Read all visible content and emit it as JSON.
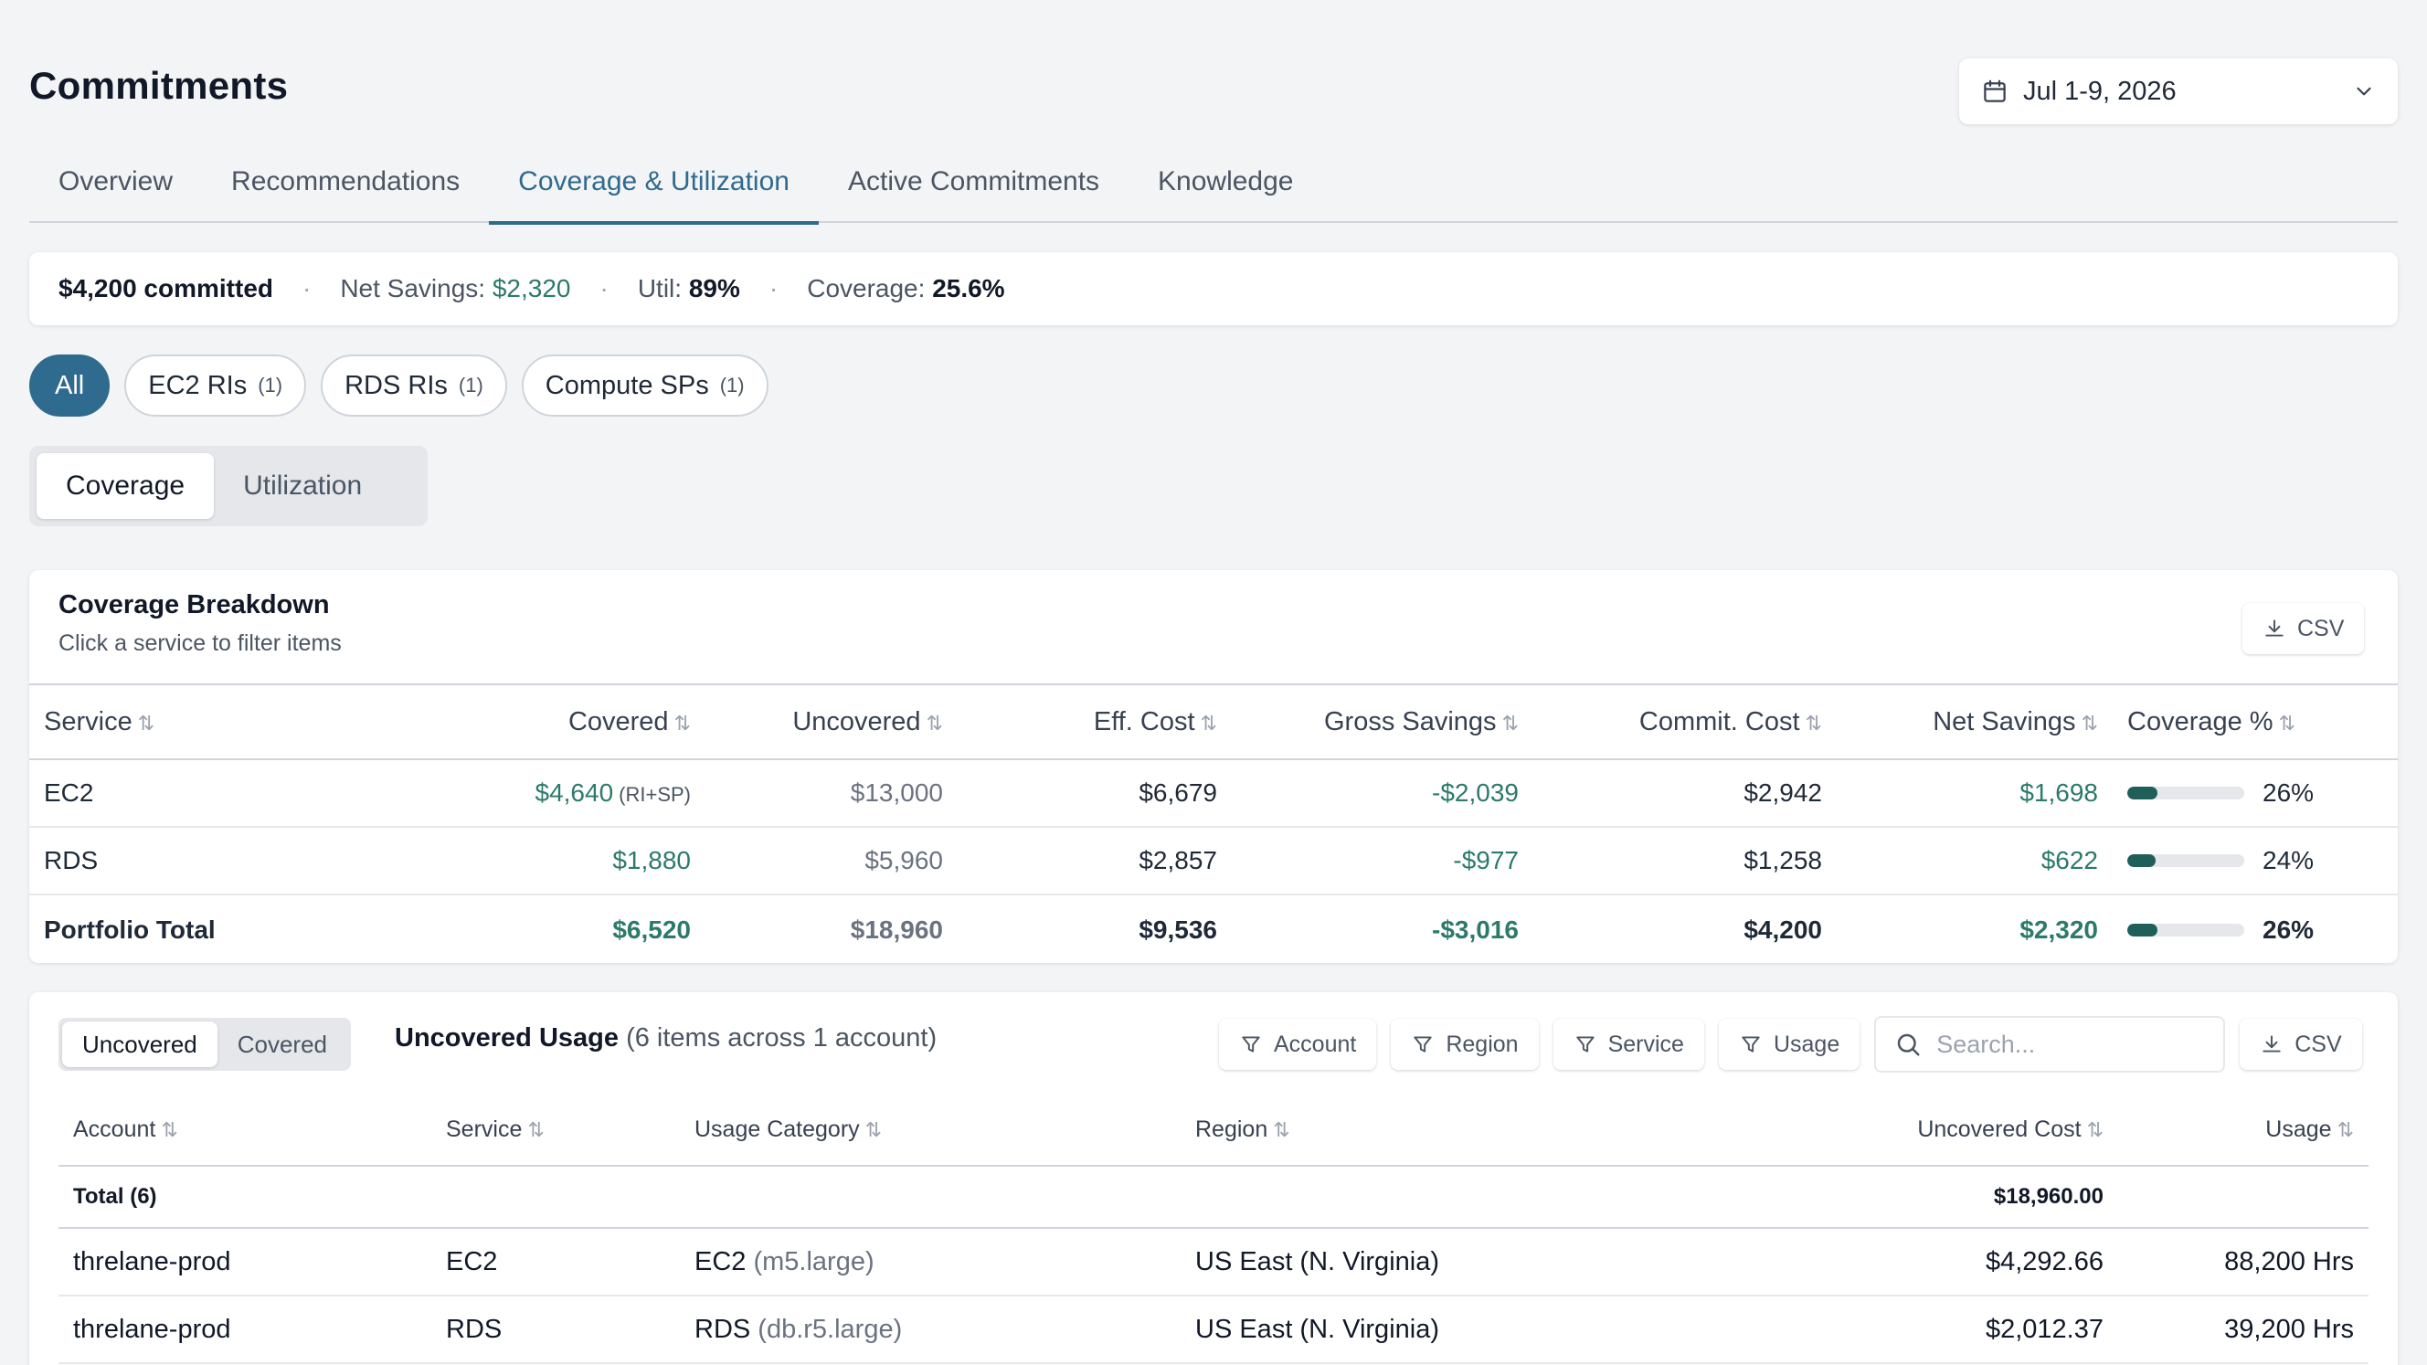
{
  "header": {
    "title": "Commitments",
    "date_range": "Jul 1-9, 2026"
  },
  "tabs": [
    {
      "label": "Overview",
      "active": false
    },
    {
      "label": "Recommendations",
      "active": false
    },
    {
      "label": "Coverage & Utilization",
      "active": true
    },
    {
      "label": "Active Commitments",
      "active": false
    },
    {
      "label": "Knowledge",
      "active": false
    }
  ],
  "summary": {
    "committed": "$4,200 committed",
    "net_savings_label": "Net Savings:",
    "net_savings_value": "$2,320",
    "util_label": "Util:",
    "util_value": "89%",
    "coverage_label": "Coverage:",
    "coverage_value": "25.6%",
    "separator": "·"
  },
  "pills": [
    {
      "label": "All",
      "count": "",
      "active": true
    },
    {
      "label": "EC2 RIs",
      "count": "(1)",
      "active": false
    },
    {
      "label": "RDS RIs",
      "count": "(1)",
      "active": false
    },
    {
      "label": "Compute SPs",
      "count": "(1)",
      "active": false
    }
  ],
  "view_toggle": {
    "coverage": "Coverage",
    "utilization": "Utilization"
  },
  "breakdown": {
    "title": "Coverage Breakdown",
    "subtitle": "Click a service to filter items",
    "csv_label": "CSV",
    "columns": [
      "Service",
      "Covered",
      "Uncovered",
      "Eff. Cost",
      "Gross Savings",
      "Commit. Cost",
      "Net Savings",
      "Coverage %"
    ],
    "sort_glyph": "⇅",
    "rows": [
      {
        "service": "EC2",
        "covered": "$4,640",
        "covered_suffix": "(RI+SP)",
        "uncovered": "$13,000",
        "eff_cost": "$6,679",
        "gross_savings": "-$2,039",
        "commit_cost": "$2,942",
        "net_savings": "$1,698",
        "coverage_pct": "26%",
        "coverage_value": 26
      },
      {
        "service": "RDS",
        "covered": "$1,880",
        "covered_suffix": "",
        "uncovered": "$5,960",
        "eff_cost": "$2,857",
        "gross_savings": "-$977",
        "commit_cost": "$1,258",
        "net_savings": "$622",
        "coverage_pct": "24%",
        "coverage_value": 24
      }
    ],
    "total": {
      "service": "Portfolio Total",
      "covered": "$6,520",
      "uncovered": "$18,960",
      "eff_cost": "$9,536",
      "gross_savings": "-$3,016",
      "commit_cost": "$4,200",
      "net_savings": "$2,320",
      "coverage_pct": "26%",
      "coverage_value": 26
    }
  },
  "usage": {
    "toggle_uncovered": "Uncovered",
    "toggle_covered": "Covered",
    "title": "Uncovered Usage",
    "title_detail": "(6 items across 1 account)",
    "filters": [
      "Account",
      "Region",
      "Service",
      "Usage"
    ],
    "search_placeholder": "Search...",
    "csv_label": "CSV",
    "total_label": "Total (6)",
    "total_cost": "$18,960.00",
    "columns": [
      "Account",
      "Service",
      "Usage Category",
      "Region",
      "Uncovered Cost",
      "Usage"
    ],
    "rows": [
      {
        "account": "threlane-prod",
        "service": "EC2",
        "category": "EC2",
        "category_detail": "(m5.large)",
        "region": "US East (N. Virginia)",
        "cost": "$4,292.66",
        "usage": "88,200 Hrs"
      },
      {
        "account": "threlane-prod",
        "service": "RDS",
        "category": "RDS",
        "category_detail": "(db.r5.large)",
        "region": "US East (N. Virginia)",
        "cost": "$2,012.37",
        "usage": "39,200 Hrs"
      }
    ]
  },
  "colors": {
    "accent": "#2f6a8f",
    "positive": "#2c7a6a",
    "bar_fill": "#1f5f5a"
  }
}
